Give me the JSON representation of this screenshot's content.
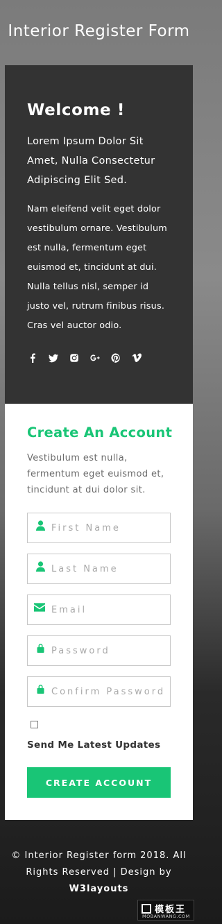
{
  "page": {
    "title": "Interior Register Form"
  },
  "welcome": {
    "heading": "Welcome !",
    "lead": "Lorem Ipsum Dolor Sit Amet, Nulla Consectetur Adipiscing Elit Sed.",
    "body": "Nam eleifend velit eget dolor vestibulum ornare. Vestibulum est nulla, fermentum eget euismod et, tincidunt at dui. Nulla tellus nisl, semper id justo vel, rutrum finibus risus. Cras vel auctor odio.",
    "social": [
      "facebook-icon",
      "twitter-icon",
      "instagram-icon",
      "google-plus-icon",
      "pinterest-icon",
      "vimeo-icon"
    ]
  },
  "form": {
    "heading": "Create An Account",
    "description": "Vestibulum est nulla, fermentum eget euismod et, tincidunt at dui dolor sit.",
    "fields": {
      "first_name": {
        "placeholder": "First Name",
        "icon": "user-icon"
      },
      "last_name": {
        "placeholder": "Last Name",
        "icon": "user-icon"
      },
      "email": {
        "placeholder": "Email",
        "icon": "envelope-icon"
      },
      "password": {
        "placeholder": "Password",
        "icon": "lock-icon"
      },
      "confirm_password": {
        "placeholder": "Confirm Password",
        "icon": "lock-icon"
      }
    },
    "checkbox_label": "Send Me Latest Updates",
    "submit_label": "CREATE ACCOUNT"
  },
  "footer": {
    "text": "© Interior Register form 2018. All Rights Reserved | Design by",
    "link": "W3layouts"
  },
  "watermark": {
    "title": "模板王",
    "sub": "MOBANWANG.COM"
  },
  "colors": {
    "accent": "#19c576",
    "panel": "#333333",
    "card": "#ffffff"
  }
}
